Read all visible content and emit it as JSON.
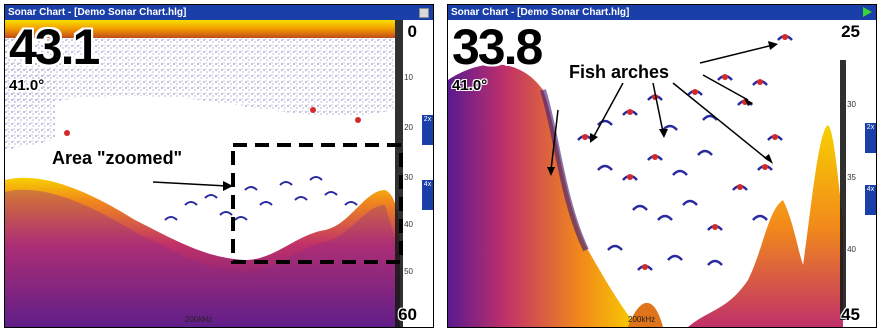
{
  "left_panel": {
    "title": "Sonar Chart - [Demo Sonar Chart.hlg]",
    "depth": "43.1",
    "temp": "41.0°",
    "scale_top": "0",
    "scale_bottom": "60",
    "ticks": [
      "10",
      "20",
      "30",
      "40",
      "50"
    ],
    "frequency": "200kHz",
    "zoom_buttons": [
      "2x",
      "4x"
    ],
    "callout": "Area \"zoomed\""
  },
  "right_panel": {
    "title": "Sonar Chart - [Demo Sonar Chart.hlg]",
    "depth": "33.8",
    "temp": "41.0°",
    "scale_top": "25",
    "scale_bottom": "45",
    "ticks": [
      "30",
      "35",
      "40"
    ],
    "frequency": "200kHz",
    "zoom_buttons": [
      "2x",
      "4x"
    ],
    "callout": "Fish arches"
  },
  "colors": {
    "titlebar": "#1a3fa8",
    "sonar_hot": "#f7b500",
    "sonar_mid": "#e0541e",
    "sonar_deep": "#6b1a8a",
    "arch_blue": "#2a2aa0",
    "arch_red": "#d42a2a"
  }
}
